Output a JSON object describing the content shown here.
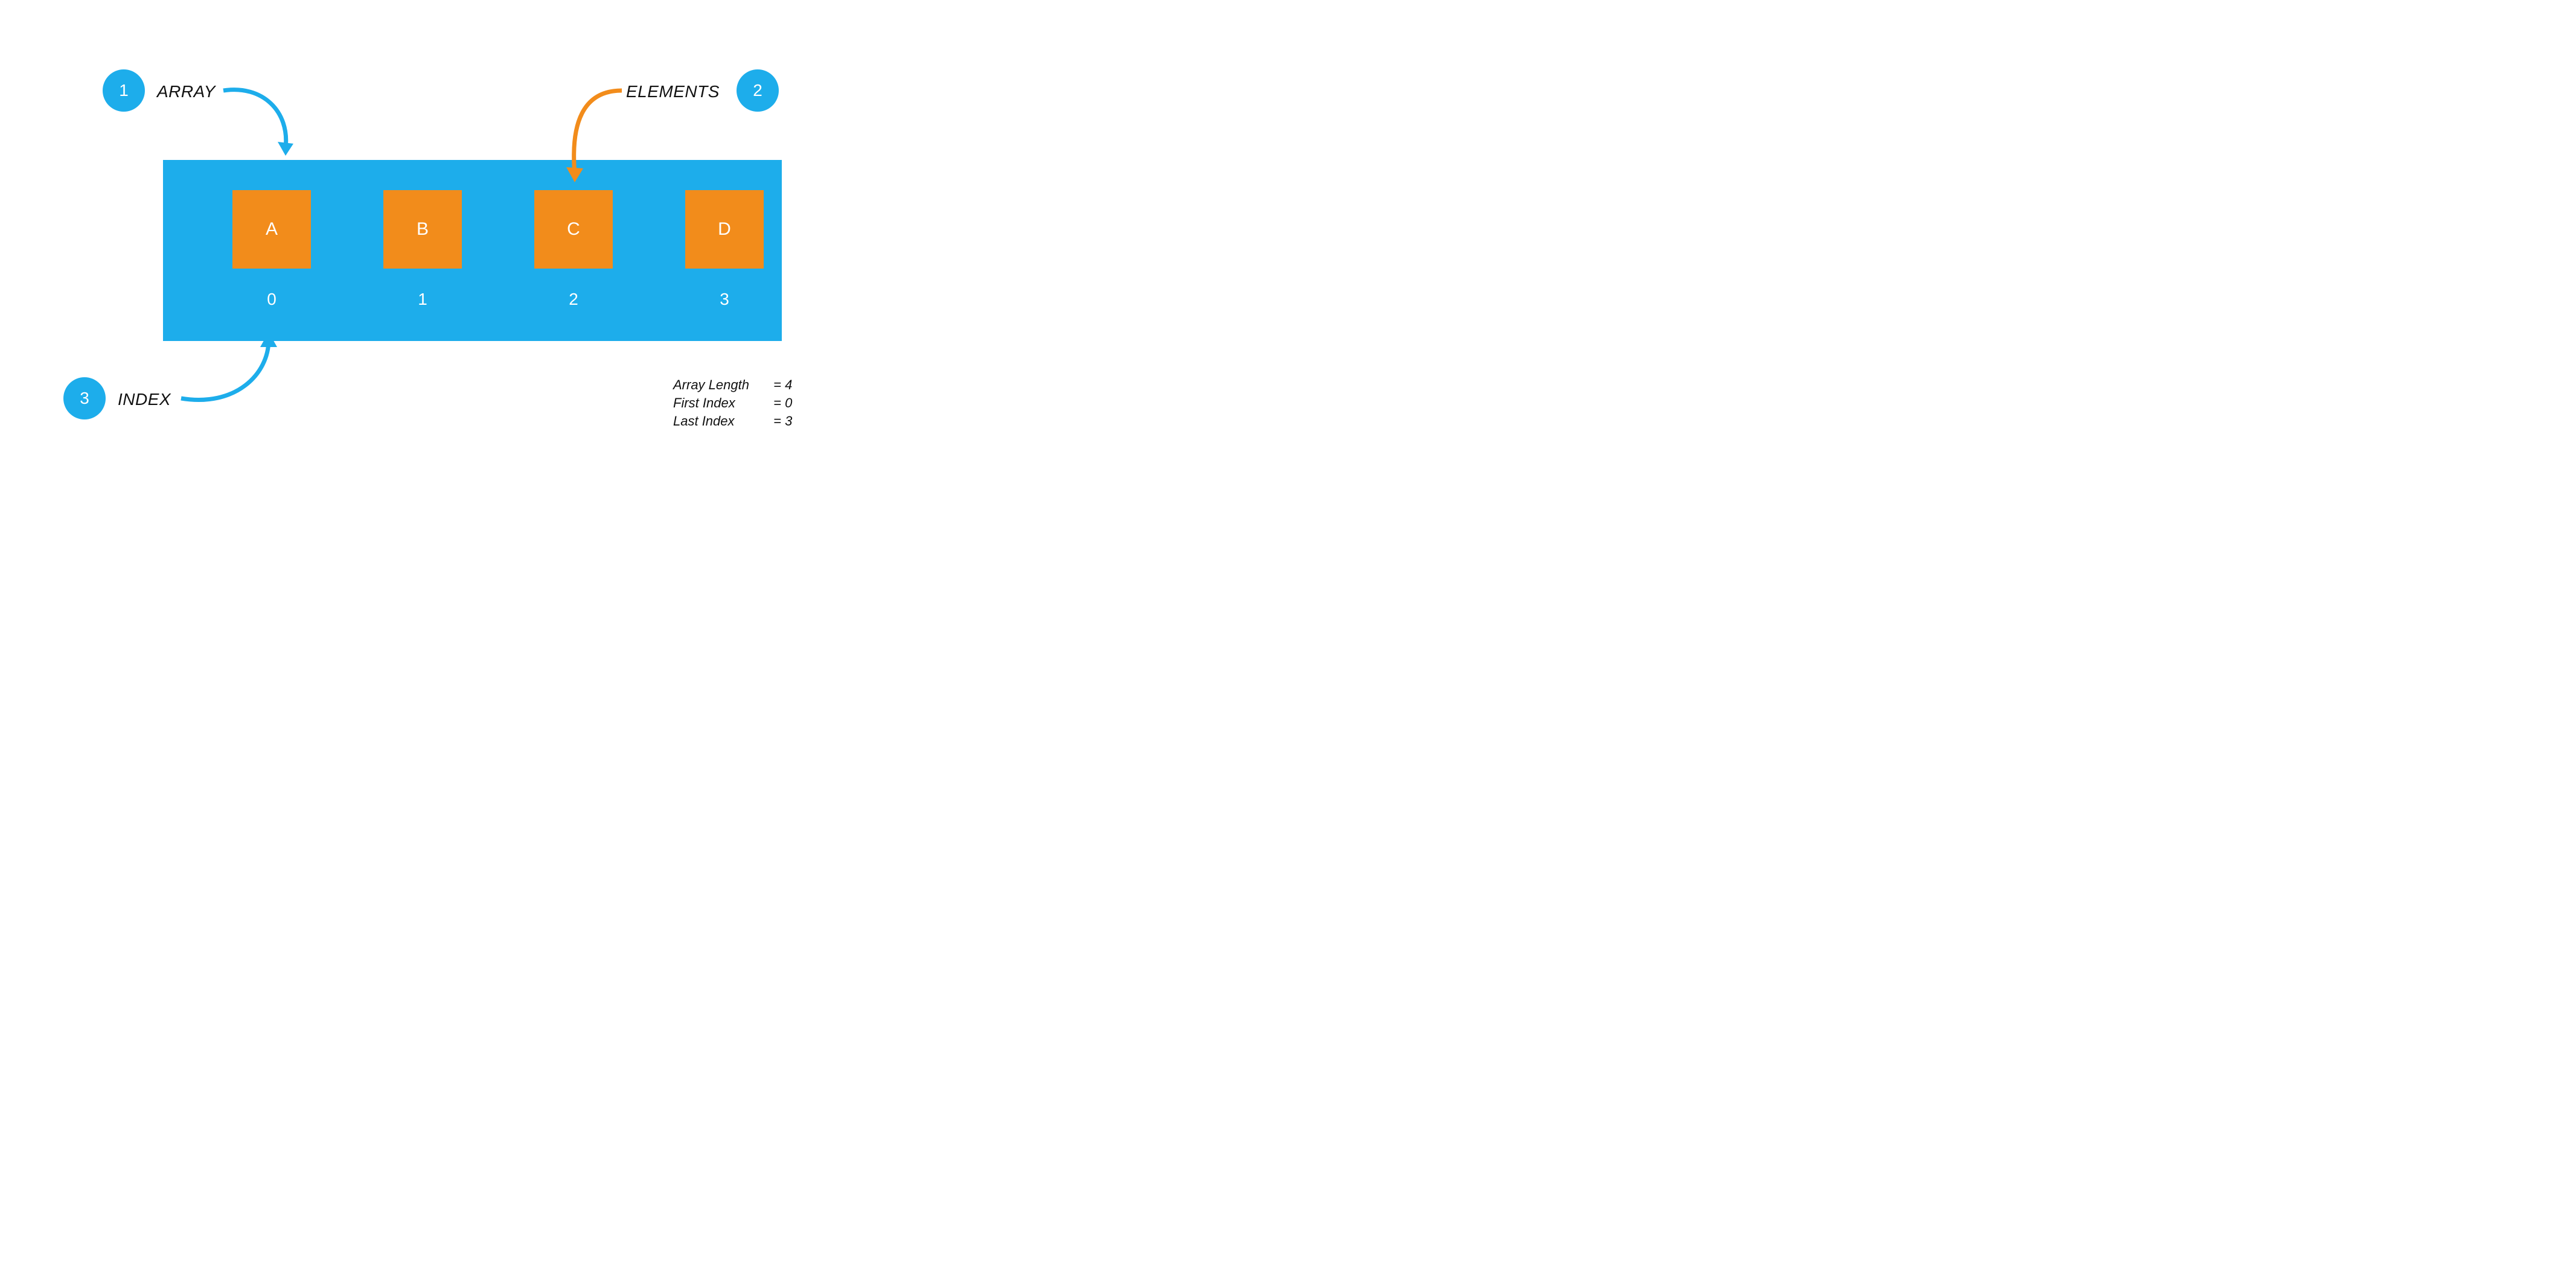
{
  "colors": {
    "blue": "#1DADEB",
    "orange": "#F28C1B"
  },
  "badges": {
    "array": "1",
    "elements": "2",
    "index": "3"
  },
  "labels": {
    "array": "ARRAY",
    "elements": "ELEMENTS",
    "index": "INDEX"
  },
  "cells": [
    {
      "value": "A",
      "index": "0"
    },
    {
      "value": "B",
      "index": "1"
    },
    {
      "value": "C",
      "index": "2"
    },
    {
      "value": "D",
      "index": "3"
    }
  ],
  "info": {
    "length": {
      "label": "Array Length",
      "value": "= 4"
    },
    "first": {
      "label": "First Index",
      "value": "= 0"
    },
    "last": {
      "label": "Last Index",
      "value": "= 3"
    }
  }
}
